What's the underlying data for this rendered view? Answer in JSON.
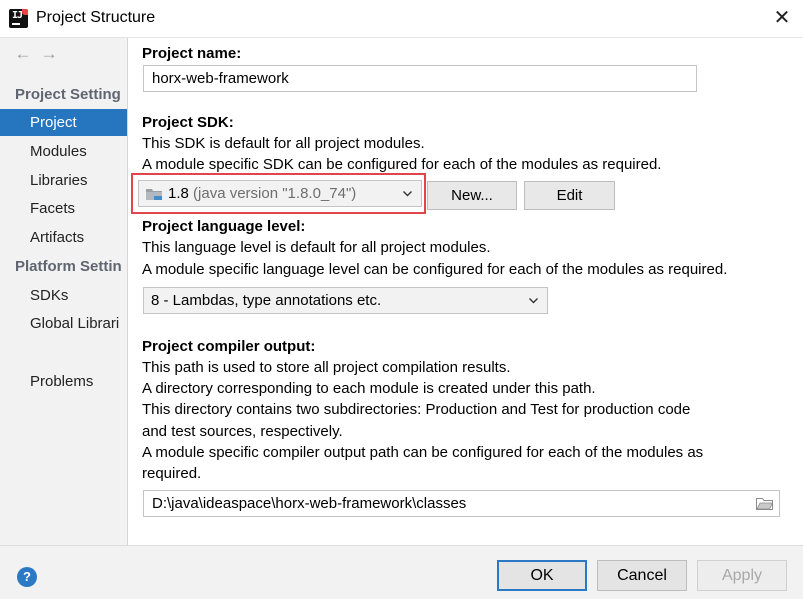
{
  "window": {
    "title": "Project Structure",
    "app_icon": "intellij-idea-icon",
    "close_glyph": "✕"
  },
  "sidebar": {
    "nav_back": "←",
    "nav_forward": "→",
    "sections": [
      {
        "title": "Project Setting",
        "items": [
          "Project",
          "Modules",
          "Libraries",
          "Facets",
          "Artifacts"
        ]
      },
      {
        "title": "Platform Settin",
        "items": [
          "SDKs",
          "Global Librari"
        ]
      }
    ],
    "extra_items": [
      "Problems"
    ],
    "selected": "Project",
    "selected_color": "#2675bf"
  },
  "project": {
    "name_label": "Project name:",
    "name_value": "horx-web-framework",
    "sdk_label": "Project SDK:",
    "sdk_desc1": "This SDK is default for all project modules.",
    "sdk_desc2": "A module specific SDK can be configured for each of the modules as required.",
    "sdk_version": "1.8",
    "sdk_detail": "(java version \"1.8.0_74\")",
    "sdk_new_button": "New...",
    "sdk_edit_button": "Edit",
    "sdk_highlight_color": "#e0454b",
    "lang_label": "Project language level:",
    "lang_desc1": "This language level is default for all project modules.",
    "lang_desc2": "A module specific language level can be configured for each of the modules as required.",
    "lang_value": "8 - Lambdas, type annotations etc.",
    "output_label": "Project compiler output:",
    "output_desc": [
      "This path is used to store all project compilation results.",
      "A directory corresponding to each module is created under this path.",
      "This directory contains two subdirectories: Production and Test for production code",
      "and test sources, respectively.",
      "A module specific compiler output path can be configured for each of the modules as",
      "required."
    ],
    "output_path": "D:\\java\\ideaspace\\horx-web-framework\\classes"
  },
  "footer": {
    "help": "?",
    "ok": "OK",
    "cancel": "Cancel",
    "apply": "Apply",
    "accent_color": "#2b78c5"
  }
}
